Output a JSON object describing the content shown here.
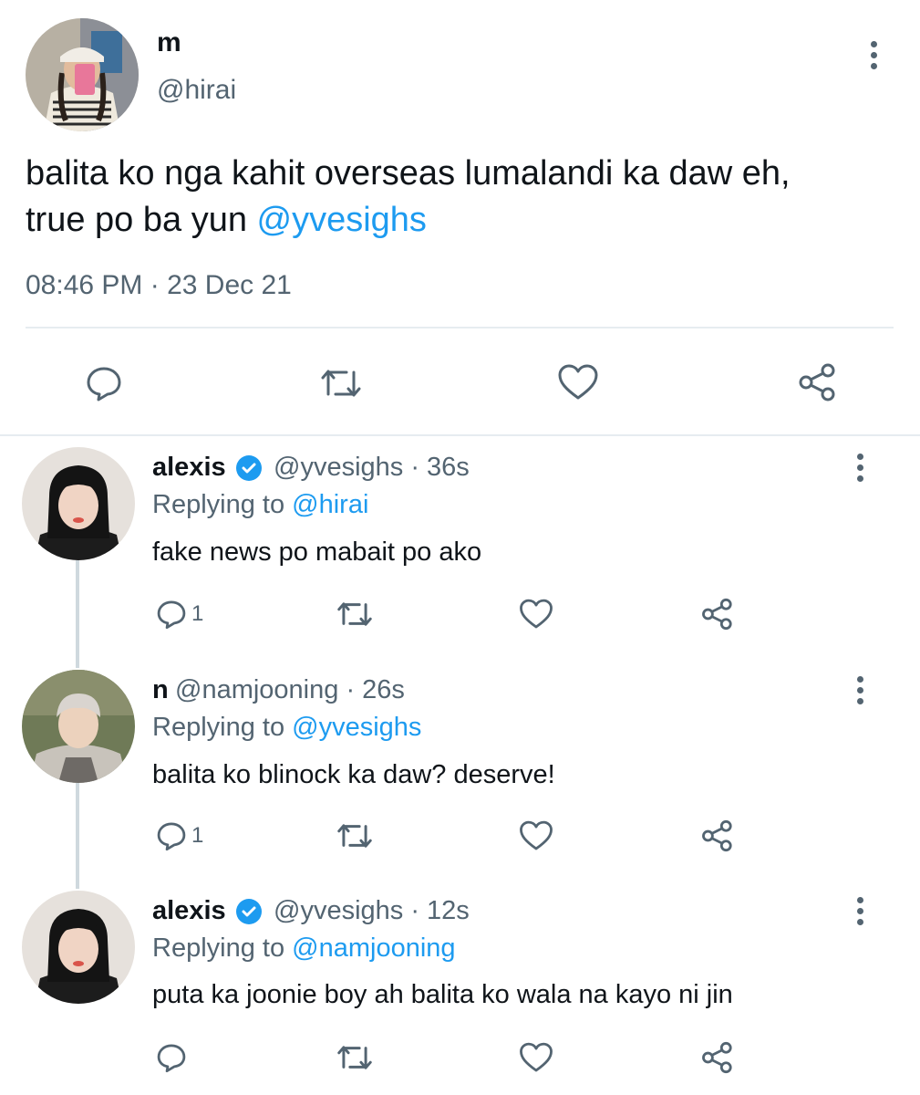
{
  "main_tweet": {
    "name": "m",
    "handle": "@hirai",
    "text": "balita ko nga kahit overseas lumalandi ka daw eh,",
    "text_line2": "true po ba yun ",
    "mention": "@yvesighs",
    "time": "08:46 PM",
    "separator": " · ",
    "date": "23 Dec 21",
    "actions": [
      "reply-icon",
      "retweet-icon",
      "like-icon",
      "share-icon"
    ]
  },
  "replies": [
    {
      "name": "alexis",
      "verified": true,
      "handle": "@yvesighs",
      "time": " · 36s",
      "replying_label": "Replying to ",
      "replying_to": "@hirai",
      "text": "fake news po mabait po ako",
      "reply_count": "1"
    },
    {
      "name": "n",
      "verified": false,
      "handle": "@namjooning",
      "time": " · 26s",
      "replying_label": "Replying to ",
      "replying_to": "@yvesighs",
      "text": "balita ko blinock ka daw? deserve!",
      "reply_count": "1"
    },
    {
      "name": "alexis",
      "verified": true,
      "handle": "@yvesighs",
      "time": " · 12s",
      "replying_label": "Replying to ",
      "replying_to": "@namjooning",
      "text": "puta ka joonie boy ah balita ko wala na kayo ni jin",
      "reply_count": ""
    }
  ],
  "colors": {
    "text": "#0f1419",
    "secondary": "#536471",
    "accent": "#1d9bf0",
    "divider": "#e6ecf0"
  }
}
